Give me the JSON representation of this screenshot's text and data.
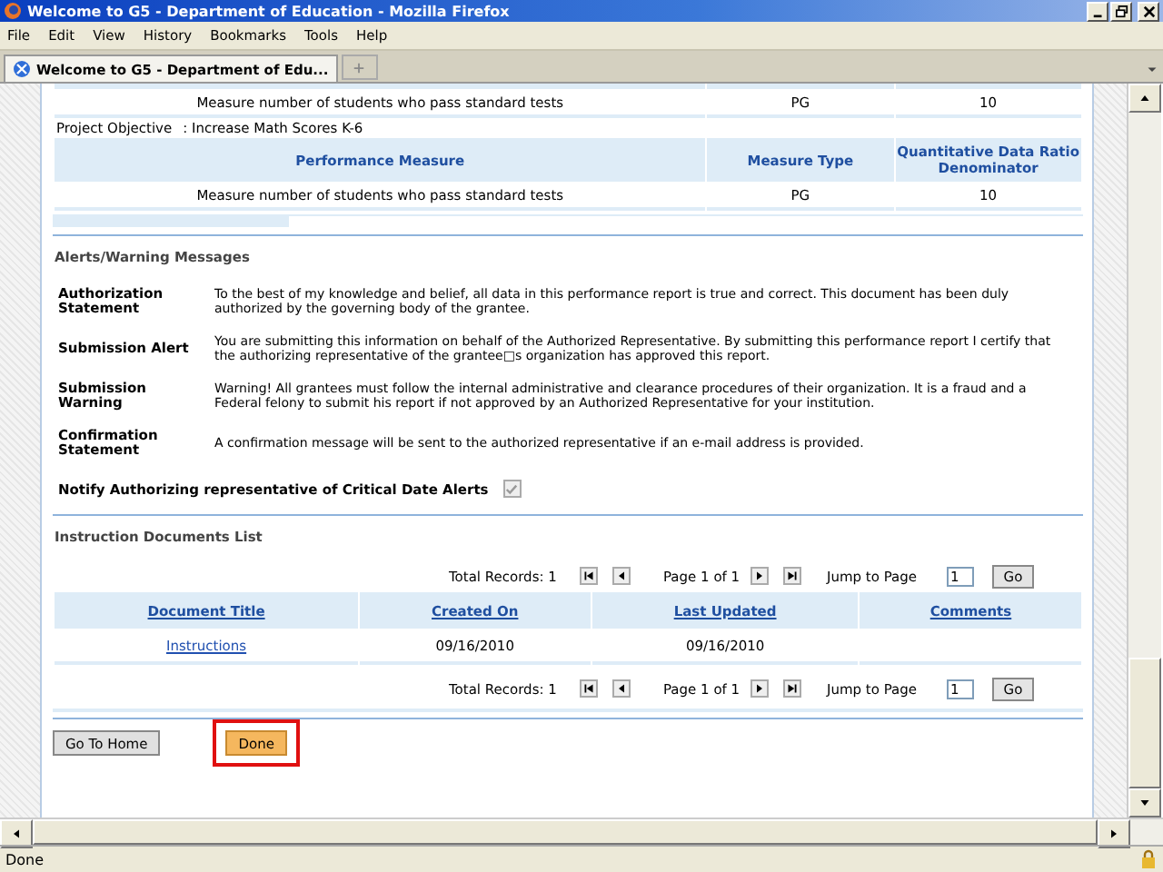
{
  "window": {
    "title": "Welcome to G5 - Department of Education - Mozilla Firefox"
  },
  "menu": [
    "File",
    "Edit",
    "View",
    "History",
    "Bookmarks",
    "Tools",
    "Help"
  ],
  "tabs": [
    {
      "label": "Welcome to G5 - Department of Edu...",
      "selected": true
    }
  ],
  "top_row": {
    "measure": "Measure number of students who pass standard tests",
    "type": "PG",
    "value": "10"
  },
  "project_objective": {
    "label": "Project Objective",
    "value": ": Increase Math Scores K-6"
  },
  "measures_table": {
    "columns": [
      "Performance Measure",
      "Measure Type",
      "Quantitative Data Ratio Denominator"
    ],
    "rows": [
      [
        "Measure number of students who pass standard tests",
        "PG",
        "10"
      ]
    ]
  },
  "alerts": {
    "heading": "Alerts/Warning Messages",
    "items": [
      {
        "label": "Authorization Statement",
        "text": "To the best of my knowledge and belief, all data in this performance report is true and correct. This document has been duly authorized by the governing body of the grantee."
      },
      {
        "label": "Submission Alert",
        "text": "You are submitting this information on behalf of the Authorized Representative. By submitting this performance report I certify that the authorizing representative of the grantee□s organization has approved this report."
      },
      {
        "label": "Submission Warning",
        "text": "Warning! All grantees must follow the internal administrative and clearance procedures of their organization. It is a fraud and a Federal felony to submit his report if not approved by an Authorized Representative for your institution."
      },
      {
        "label": "Confirmation Statement",
        "text": "A confirmation message will be sent to the authorized representative if an e-mail address is provided."
      }
    ],
    "notify": {
      "label": "Notify Authorizing representative of Critical Date Alerts",
      "checked": true,
      "disabled": true
    }
  },
  "documents": {
    "heading": "Instruction Documents List",
    "pagers": [
      {
        "total": "Total Records: 1",
        "page": "Page 1 of 1",
        "jump_label": "Jump to Page",
        "jump_value": "1",
        "go": "Go"
      },
      {
        "total": "Total Records: 1",
        "page": "Page 1 of 1",
        "jump_label": "Jump to Page",
        "jump_value": "1",
        "go": "Go"
      }
    ],
    "columns": [
      "Document Title",
      "Created On",
      "Last Updated",
      "Comments"
    ],
    "rows": [
      [
        "Instructions",
        "09/16/2010",
        "09/16/2010"
      ]
    ]
  },
  "buttons": [
    {
      "label": "Go To Home",
      "highlighted": false
    },
    {
      "label": "Done",
      "highlighted": true
    }
  ],
  "status_bar": "Done"
}
